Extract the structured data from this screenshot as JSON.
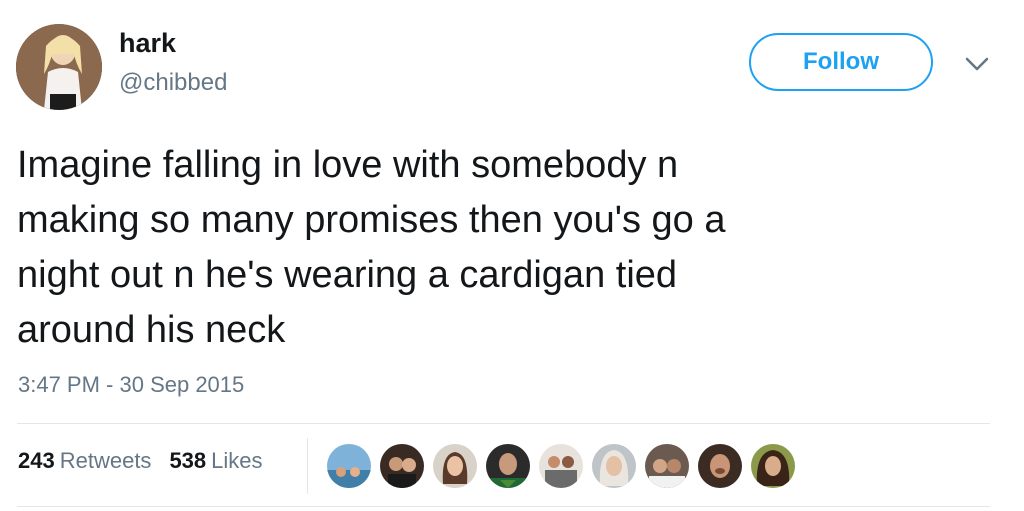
{
  "user": {
    "name": "hark",
    "handle": "@chibbed"
  },
  "header": {
    "follow_label": "Follow",
    "menu_icon": "chevron-down-icon"
  },
  "tweet": {
    "text": "Imagine falling in love with somebody n\nmaking so many promises then you's go a\nnight out n he's wearing a cardigan tied\naround his neck",
    "timestamp": "3:47 PM - 30 Sep 2015"
  },
  "stats": {
    "retweets_count": "243",
    "retweets_label": "Retweets",
    "likes_count": "538",
    "likes_label": "Likes"
  },
  "colors": {
    "accent": "#1da1f2",
    "text_primary": "#14171a",
    "text_secondary": "#657786",
    "divider": "#e1e8ed"
  }
}
